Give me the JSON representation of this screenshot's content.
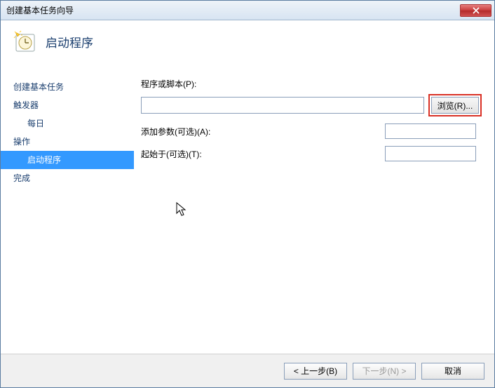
{
  "window": {
    "title": "创建基本任务向导"
  },
  "header": {
    "heading": "启动程序"
  },
  "sidebar": {
    "items": [
      {
        "label": "创建基本任务",
        "type": "top"
      },
      {
        "label": "触发器",
        "type": "top"
      },
      {
        "label": "每日",
        "type": "sub",
        "selected": false
      },
      {
        "label": "操作",
        "type": "top"
      },
      {
        "label": "启动程序",
        "type": "sub",
        "selected": true
      },
      {
        "label": "完成",
        "type": "top"
      }
    ]
  },
  "form": {
    "script_label": "程序或脚本(P):",
    "script_value": "",
    "browse_label": "浏览(R)...",
    "args_label": "添加参数(可选)(A):",
    "args_value": "",
    "startin_label": "起始于(可选)(T):",
    "startin_value": ""
  },
  "footer": {
    "back": "< 上一步(B)",
    "next": "下一步(N) >",
    "cancel": "取消"
  }
}
